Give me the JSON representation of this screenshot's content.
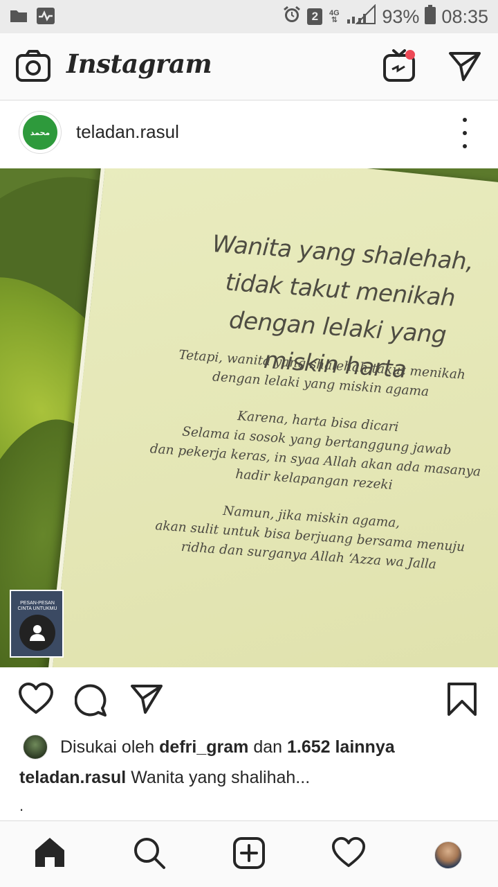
{
  "status_bar": {
    "sim_badge": "2",
    "network": "4G",
    "battery": "93%",
    "time": "08:35",
    "icons": [
      "folder-icon",
      "activity-icon",
      "alarm-icon",
      "signal-icon",
      "battery-icon"
    ]
  },
  "header": {
    "title": "Instagram",
    "icons": [
      "camera-icon",
      "igtv-icon",
      "direct-message-icon"
    ],
    "notification_color": "#ed4956"
  },
  "post": {
    "username": "teladan.rasul",
    "avatar_text": "محمد",
    "avatar_color": "#2e9a3c",
    "image": {
      "heading_lines": [
        "Wanita yang shalehah,",
        "tidak takut menikah",
        "dengan lelaki yang miskin harta"
      ],
      "paragraphs": [
        [
          "Tetapi, wanita yang shalehah takut menikah",
          "dengan lelaki yang miskin agama"
        ],
        [
          "Karena, harta bisa dicari",
          "Selama ia sosok yang bertanggung jawab",
          "dan pekerja keras, in syaa Allah akan ada masanya",
          "hadir kelapangan rezeki"
        ],
        [
          "Namun, jika miskin agama,",
          "akan sulit untuk bisa berjuang bersama menuju",
          "ridha dan surganya Allah ‘Azza wa Jalla"
        ]
      ],
      "tag_title": "PESAN-PESAN CINTA UNTUKMU"
    },
    "likes": {
      "prefix": "Disukai oleh",
      "user": "defri_gram",
      "joiner": "dan",
      "count_text": "1.652 lainnya"
    },
    "caption": {
      "username": "teladan.rasul",
      "text": "Wanita yang shalihah...",
      "extra": "."
    }
  },
  "bottom_nav": {
    "items": [
      "home-icon",
      "search-icon",
      "add-post-icon",
      "activity-heart-icon",
      "profile-avatar"
    ]
  }
}
